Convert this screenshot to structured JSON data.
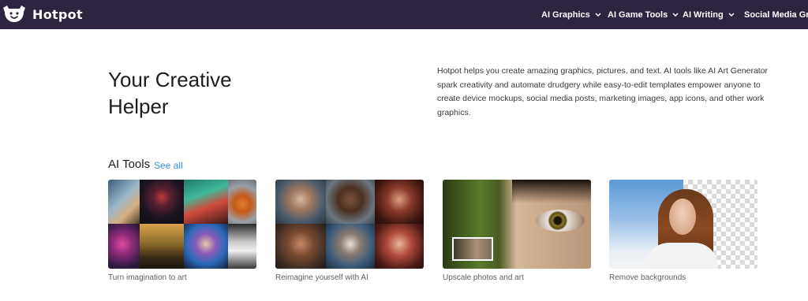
{
  "header": {
    "brand": "Hotpot",
    "nav": [
      {
        "label": "AI Graphics",
        "has_dropdown": true
      },
      {
        "label": "AI Game Tools",
        "has_dropdown": true
      },
      {
        "label": "AI Writing",
        "has_dropdown": true
      },
      {
        "label": "Social Media Graph",
        "has_dropdown": false
      }
    ]
  },
  "hero": {
    "title": "Your Creative Helper",
    "description": "Hotpot helps you create amazing graphics, pictures, and text. AI tools like AI Art Generator spark creativity and automate drudgery while easy-to-edit templates empower anyone to create device mockups, social media posts, marketing images, app icons, and other work graphics."
  },
  "tools_section": {
    "title": "AI Tools",
    "see_all": "See all",
    "cards": [
      {
        "caption": "Turn imagination to art"
      },
      {
        "caption": "Reimagine yourself with AI"
      },
      {
        "caption": "Upscale photos and art"
      },
      {
        "caption": "Remove backgrounds"
      }
    ]
  },
  "colors": {
    "header_bg": "#2e2440",
    "link": "#3d8fe0",
    "text": "#1d1d1f"
  }
}
